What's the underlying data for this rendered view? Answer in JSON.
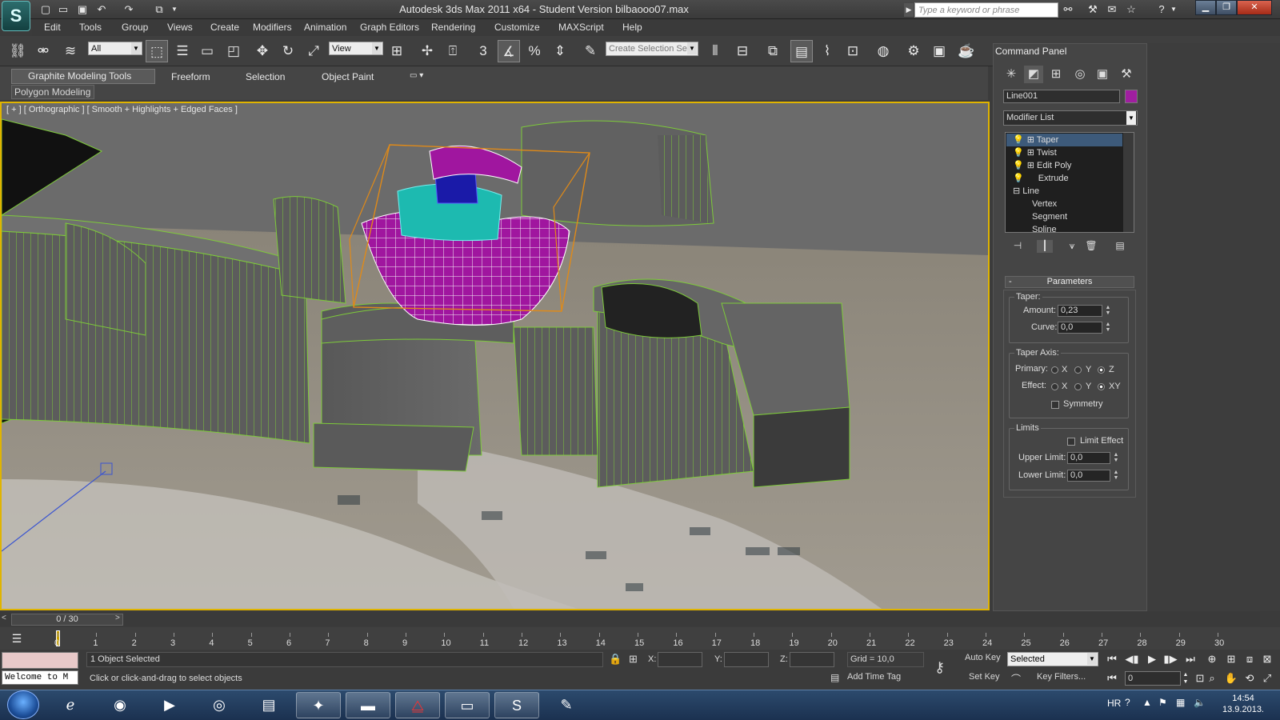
{
  "titlebar": {
    "title": "Autodesk 3ds Max  2011 x64  - Student Version    bilbaooo07.max",
    "search_placeholder": "Type a keyword or phrase",
    "logo": "max-logo"
  },
  "menu": [
    "Edit",
    "Tools",
    "Group",
    "Views",
    "Create",
    "Modifiers",
    "Animation",
    "Graph Editors",
    "Rendering",
    "Customize",
    "MAXScript",
    "Help"
  ],
  "toolbar": {
    "filter_value": "All",
    "refcoord_value": "View",
    "selection_set_placeholder": "Create Selection Se",
    "snap_numbers": [
      "3",
      "%"
    ]
  },
  "ribbon": {
    "tabs": [
      "Graphite Modeling Tools",
      "Freeform",
      "Selection",
      "Object Paint"
    ],
    "subtab": "Polygon Modeling"
  },
  "viewport": {
    "label": "[ + ] [ Orthographic ] [ Smooth + Highlights + Edged Faces ]",
    "border_color": "#e0b400"
  },
  "command_panel": {
    "title": "Command Panel",
    "object_name": "Line001",
    "object_color": "#a01ea0",
    "modifier_list_label": "Modifier List",
    "stack": [
      {
        "label": "Taper",
        "selected": true
      },
      {
        "label": "Twist",
        "selected": false
      },
      {
        "label": "Edit Poly",
        "selected": false
      },
      {
        "label": "Extrude",
        "selected": false
      },
      {
        "label": "Line",
        "selected": false
      },
      {
        "label": "Vertex",
        "selected": false
      },
      {
        "label": "Segment",
        "selected": false
      },
      {
        "label": "Spline",
        "selected": false
      }
    ],
    "params": {
      "rollout_title": "Parameters",
      "taper_group": "Taper:",
      "amount_label": "Amount:",
      "amount_value": "0,23",
      "curve_label": "Curve:",
      "curve_value": "0,0",
      "axis_group": "Taper Axis:",
      "primary_label": "Primary:",
      "effect_label": "Effect:",
      "primary_options": [
        "X",
        "Y",
        "Z"
      ],
      "primary_selected": "Z",
      "effect_options": [
        "X",
        "Y",
        "XY"
      ],
      "effect_selected": "XY",
      "symmetry_label": "Symmetry",
      "limits_group": "Limits",
      "limit_effect_label": "Limit Effect",
      "upper_label": "Upper Limit:",
      "upper_value": "0,0",
      "lower_label": "Lower Limit:",
      "lower_value": "0,0"
    }
  },
  "timeline": {
    "slider_text": "0 / 30",
    "ticks": [
      "0",
      "1",
      "2",
      "3",
      "4",
      "5",
      "6",
      "7",
      "8",
      "9",
      "10",
      "11",
      "12",
      "13",
      "14",
      "15",
      "16",
      "17",
      "18",
      "19",
      "20",
      "21",
      "22",
      "23",
      "24",
      "25",
      "26",
      "27",
      "28",
      "29",
      "30"
    ]
  },
  "status": {
    "maxscript_text": "Welcome to M",
    "selection_text": "1 Object Selected",
    "prompt_text": "Click or click-and-drag to select objects",
    "x_label": "X:",
    "y_label": "Y:",
    "z_label": "Z:",
    "grid_text": "Grid = 10,0",
    "add_time_tag": "Add Time Tag",
    "auto_key": "Auto Key",
    "set_key": "Set Key",
    "selected_dropdown": "Selected",
    "key_filters": "Key Filters...",
    "frame_value": "0"
  },
  "taskbar": {
    "apps": [
      "ie-icon",
      "firefox-icon",
      "media-player-icon",
      "chrome-icon",
      "explorer-icon",
      "app-icon",
      "vlc-like-icon",
      "acrobat-icon",
      "remote-desktop-icon",
      "3dsmax-icon",
      "paint-icon"
    ],
    "lang": "HR",
    "time": "14:54",
    "date": "13.9.2013."
  }
}
